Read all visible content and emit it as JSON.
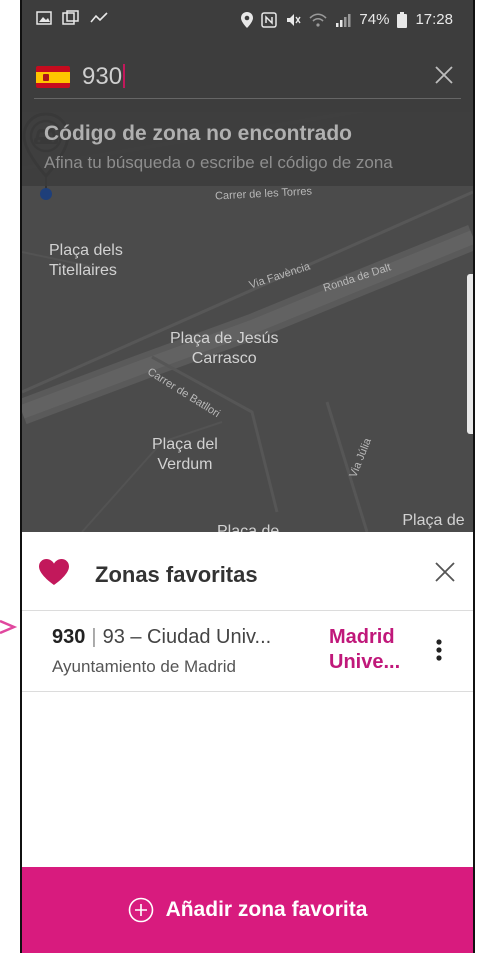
{
  "status_bar": {
    "battery": "74%",
    "time": "17:28"
  },
  "search": {
    "value": "930",
    "flag": "spain-flag"
  },
  "error": {
    "title": "Código de zona no encontrado",
    "subtitle": "Afina tu búsqueda o escribe el código de zona"
  },
  "map": {
    "places": [
      "Plaça dels\nTitellaires",
      "Plaça de Jesús\nCarrasco",
      "Plaça del\nVerdum",
      "Plaça de Sa",
      "Plaça de"
    ],
    "streets": [
      "Carrer de les Torres",
      "Via Favència",
      "Ronda de Dalt",
      "Carrer de Batllori",
      "Via Júlia"
    ],
    "pin_icon": "car-location-pin-icon"
  },
  "favorites": {
    "title": "Zonas favoritas",
    "items": [
      {
        "code": "930",
        "zone": "93 – Ciudad Univ...",
        "municipality": "Ayuntamiento de Madrid",
        "city_line1": "Madrid",
        "city_line2": "Unive..."
      }
    ],
    "add_label": "Añadir zona favorita"
  },
  "colors": {
    "accent": "#d81b7e",
    "accent_text": "#c0187a",
    "overlay": "#3d3d3d"
  }
}
